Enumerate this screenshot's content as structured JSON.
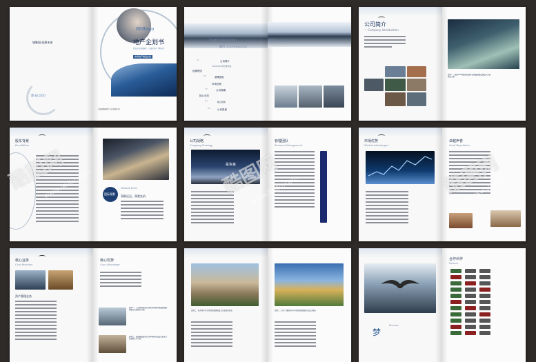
{
  "spreads": [
    {
      "id": "cover",
      "left_small_text": "城聚园·创建未来",
      "left_logo": "置·业LOGO",
      "right_script": "REBlogo",
      "right_title": "地产企划书",
      "right_small_1": "置业公司全面展示 · 让更多的人了解公司",
      "right_band": "市场地产精品企划",
      "right_footer": "上海城聚园地产企业有限公司"
    },
    {
      "id": "contents",
      "left_heading_1": "Professionalism",
      "left_heading_2": "强久 Community",
      "right_heading": "精彩 Excellence",
      "toc": [
        "公司简介",
        "2005/2020市场未来",
        "经营理念",
        "管理团队",
        "市场优势",
        "公司规模",
        "核心业务",
        "核心优势",
        "公司愿景"
      ],
      "toc_numbers": [
        "01",
        "02",
        "03",
        "04",
        "05"
      ]
    },
    {
      "id": "intro",
      "heading": "公司简介",
      "heading_en": "— Company Introduction",
      "caption": "案例一：城北100米集团总部办公楼及配套设施设计方案研究计划"
    },
    {
      "id": "development",
      "heading": "股东背景",
      "heading_en": "Foundation",
      "right_cn": "国际视野",
      "right_en": "Global View",
      "right_tagline": "洞察远见，洞悉先机"
    },
    {
      "id": "strategy",
      "left_heading": "公司战略",
      "left_heading_en": "Company Strategy",
      "left_caption": "投资良",
      "right_heading": "管理团队",
      "right_heading_en": "Business Management"
    },
    {
      "id": "market",
      "left_heading": "市场优势",
      "left_heading_en": "Market Advantages",
      "right_heading": "卓越声誉",
      "right_heading_en": "Good Reputation"
    },
    {
      "id": "core",
      "left_heading": "核心业务",
      "left_heading_en": "Core Business",
      "left_sub": "资产管理业务",
      "right_heading": "核心优势",
      "right_heading_en": "Core Advantage",
      "case_1": "案例一：上海国际服务公司新址项目的落成改造整体设计方案研究计划",
      "case_2": "案例二：城城建设城市综合体项目方案设计及全方位规划工作计划"
    },
    {
      "id": "cases",
      "left_caption": "案例二：杭州青年住宅项目规划建筑设计方案研究报告",
      "right_caption": "案例三：北京飞翼商务中心项目规划建筑方案设计报告"
    },
    {
      "id": "partners",
      "left_script": "Dream",
      "left_mark": "梦",
      "right_heading": "合作伙伴",
      "right_heading_en": "Partner"
    }
  ],
  "watermark": {
    "text": "酷图网",
    "url": "www.ikutu.com"
  },
  "colors": {
    "background": "#2f2b29",
    "page": "#f8f8f8",
    "accent_blue": "#1a3560",
    "text_line": "#8d9099"
  }
}
